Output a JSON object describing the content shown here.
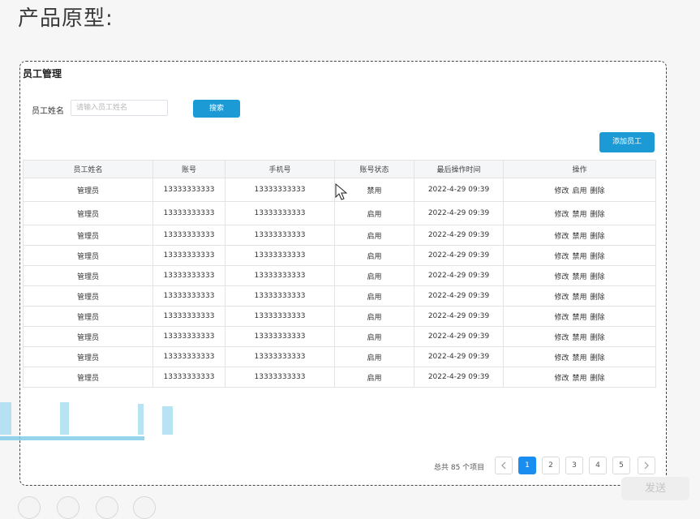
{
  "slide": {
    "title": "产品原型:"
  },
  "page": {
    "title": "员工管理",
    "search": {
      "label": "员工姓名",
      "placeholder": "请输入员工姓名",
      "button": "搜索"
    },
    "add_button": "添加员工"
  },
  "table": {
    "headers": [
      "员工姓名",
      "账号",
      "手机号",
      "账号状态",
      "最后操作时间",
      "操作"
    ],
    "rows": [
      {
        "name": "管理员",
        "account": "13333333333",
        "phone": "13333333333",
        "status": "禁用",
        "time": "2022-4-29 09:39",
        "actions": [
          "修改",
          "启用",
          "删除"
        ]
      },
      {
        "name": "管理员",
        "account": "13333333333",
        "phone": "13333333333",
        "status": "启用",
        "time": "2022-4-29 09:39",
        "actions": [
          "修改",
          "禁用",
          "删除"
        ]
      },
      {
        "name": "管理员",
        "account": "13333333333",
        "phone": "13333333333",
        "status": "启用",
        "time": "2022-4-29 09:39",
        "actions": [
          "修改",
          "禁用",
          "删除"
        ]
      },
      {
        "name": "管理员",
        "account": "13333333333",
        "phone": "13333333333",
        "status": "启用",
        "time": "2022-4-29 09:39",
        "actions": [
          "修改",
          "禁用",
          "删除"
        ]
      },
      {
        "name": "管理员",
        "account": "13333333333",
        "phone": "13333333333",
        "status": "启用",
        "time": "2022-4-29 09:39",
        "actions": [
          "修改",
          "禁用",
          "删除"
        ]
      },
      {
        "name": "管理员",
        "account": "13333333333",
        "phone": "13333333333",
        "status": "启用",
        "time": "2022-4-29 09:39",
        "actions": [
          "修改",
          "禁用",
          "删除"
        ]
      },
      {
        "name": "管理员",
        "account": "13333333333",
        "phone": "13333333333",
        "status": "启用",
        "time": "2022-4-29 09:39",
        "actions": [
          "修改",
          "禁用",
          "删除"
        ]
      },
      {
        "name": "管理员",
        "account": "13333333333",
        "phone": "13333333333",
        "status": "启用",
        "time": "2022-4-29 09:39",
        "actions": [
          "修改",
          "禁用",
          "删除"
        ]
      },
      {
        "name": "管理员",
        "account": "13333333333",
        "phone": "13333333333",
        "status": "启用",
        "time": "2022-4-29 09:39",
        "actions": [
          "修改",
          "禁用",
          "删除"
        ]
      },
      {
        "name": "管理员",
        "account": "13333333333",
        "phone": "13333333333",
        "status": "启用",
        "time": "2022-4-29 09:39",
        "actions": [
          "修改",
          "禁用",
          "删除"
        ]
      }
    ]
  },
  "pagination": {
    "total_text": "总共 85 个项目",
    "pages": [
      "1",
      "2",
      "3",
      "4",
      "5"
    ],
    "current": "1",
    "prev_icon": "chevron-left-icon",
    "next_icon": "chevron-right-icon"
  },
  "overlay": {
    "send_label": "发送"
  },
  "colors": {
    "primary": "#1b9ad6",
    "page_active": "#1a8ef0",
    "border": "#e3e3e3"
  }
}
